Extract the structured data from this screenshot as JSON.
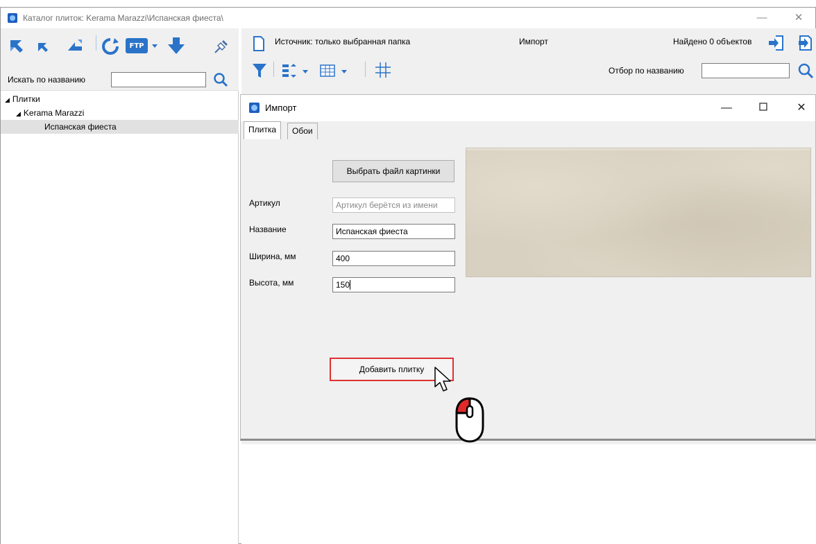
{
  "caption_cropped": "",
  "window": {
    "title": "Каталог плиток: Kerama Marazzi\\Испанская фиеста\\",
    "controls": {
      "minimize": "—",
      "maximize": "☐",
      "close": "✕"
    }
  },
  "left_toolbar": {
    "icons": [
      "expand-all-icon",
      "collapse-icon",
      "collapse-all-icon",
      "refresh-icon",
      "ftp-icon",
      "download-icon",
      "pin-icon"
    ],
    "ftp_label": "FTP"
  },
  "search": {
    "label": "Искать по названию",
    "value": ""
  },
  "tree": {
    "items": [
      {
        "label": "Плитки",
        "arrow": "◢"
      },
      {
        "label": "Kerama Marazzi",
        "arrow": "◢"
      },
      {
        "label": "Испанская фиеста",
        "arrow": ""
      }
    ]
  },
  "right_toolbar": {
    "source_label": "Источник: только выбранная папка",
    "import_label": "Импорт",
    "found_label": "Найдено 0 объектов",
    "filter_label": "Отбор по названию",
    "filter_value": ""
  },
  "dialog": {
    "title": "Импорт",
    "controls": {
      "minimize": "—",
      "maximize": "☐",
      "close": "✕"
    },
    "tabs": [
      {
        "label": "Плитка",
        "active": true
      },
      {
        "label": "Обои",
        "active": false
      }
    ],
    "choose_file_button": "Выбрать файл картинки",
    "fields": {
      "article": {
        "label": "Артикул",
        "value": "",
        "placeholder": "Артикул берётся из имени"
      },
      "name": {
        "label": "Название",
        "value": "Испанская фиеста"
      },
      "width": {
        "label": "Ширина, мм",
        "value": "400"
      },
      "height": {
        "label": "Высота, мм",
        "value": "150"
      }
    },
    "add_button": "Добавить плитку"
  },
  "colors": {
    "accent_blue": "#1f6fd1",
    "highlight_red": "#e03030",
    "toolbar_bg": "#f0f0f0"
  }
}
